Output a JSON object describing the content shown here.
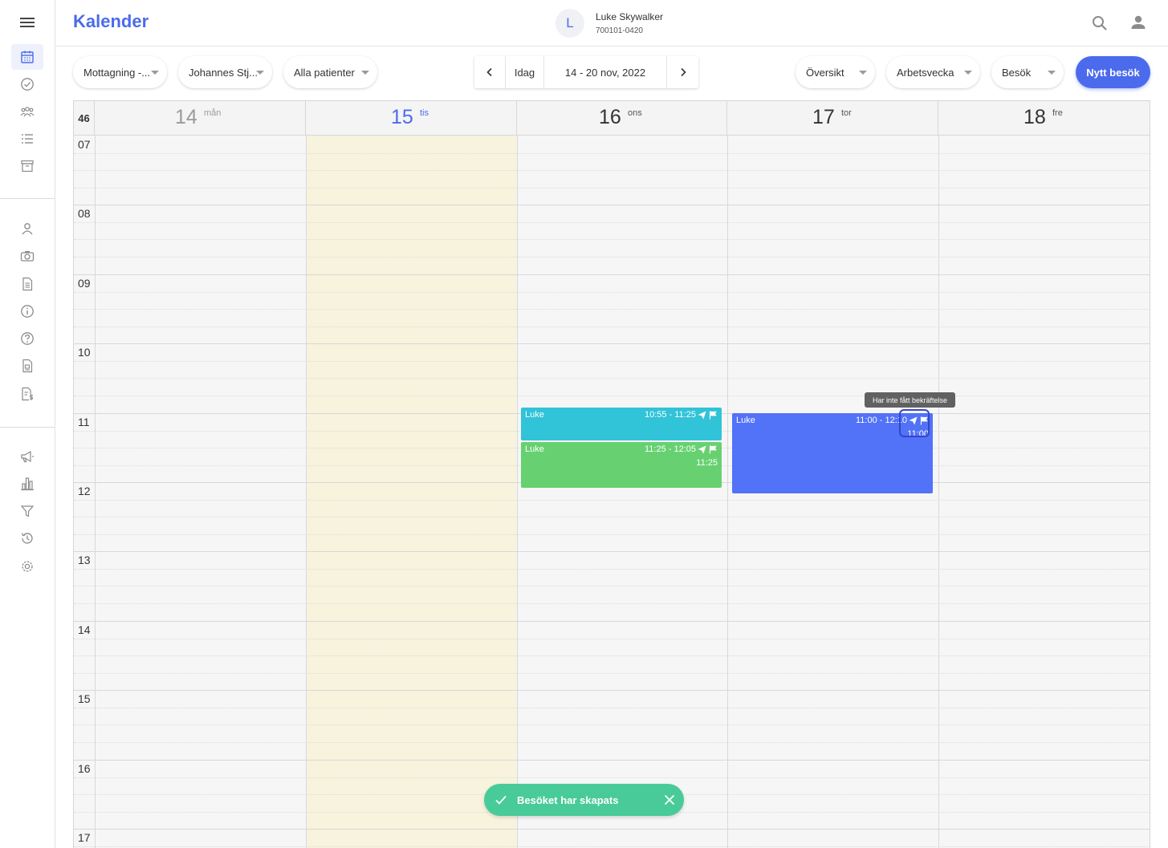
{
  "header": {
    "title": "Kalender",
    "avatar_initial": "L",
    "patient_name": "Luke Skywalker",
    "patient_id": "700101-0420"
  },
  "toolbar": {
    "filter_clinic": "Mottagning -...",
    "filter_practitioner": "Johannes Stj...",
    "filter_patients": "Alla patienter",
    "today_label": "Idag",
    "date_range": "14 - 20 nov, 2022",
    "view_overview": "Översikt",
    "view_period": "Arbetsvecka",
    "view_type": "Besök",
    "new_visit_label": "Nytt besök"
  },
  "calendar": {
    "week_number": "46",
    "days": [
      {
        "num": "14",
        "name": "mån"
      },
      {
        "num": "15",
        "name": "tis"
      },
      {
        "num": "16",
        "name": "ons"
      },
      {
        "num": "17",
        "name": "tor"
      },
      {
        "num": "18",
        "name": "fre"
      }
    ],
    "hours": [
      "07",
      "08",
      "09",
      "10",
      "11",
      "12",
      "13",
      "14",
      "15",
      "16",
      "17"
    ],
    "events": [
      {
        "patient": "Luke",
        "time": "10:55 - 11:25",
        "sub": "",
        "color": "#31c3d8"
      },
      {
        "patient": "Luke",
        "time": "11:25 - 12:05",
        "sub": "11:25",
        "color": "#67d171"
      },
      {
        "patient": "Luke",
        "time": "11:00 - 12:10",
        "sub": "11:00",
        "color": "#5272f7"
      }
    ],
    "tooltip": "Har inte fått bekräftelse"
  },
  "toast": {
    "message": "Besöket har skapats",
    "color": "#48cb98"
  },
  "colors": {
    "accent": "#4b6bec",
    "today_column": "#f7f3dc"
  }
}
